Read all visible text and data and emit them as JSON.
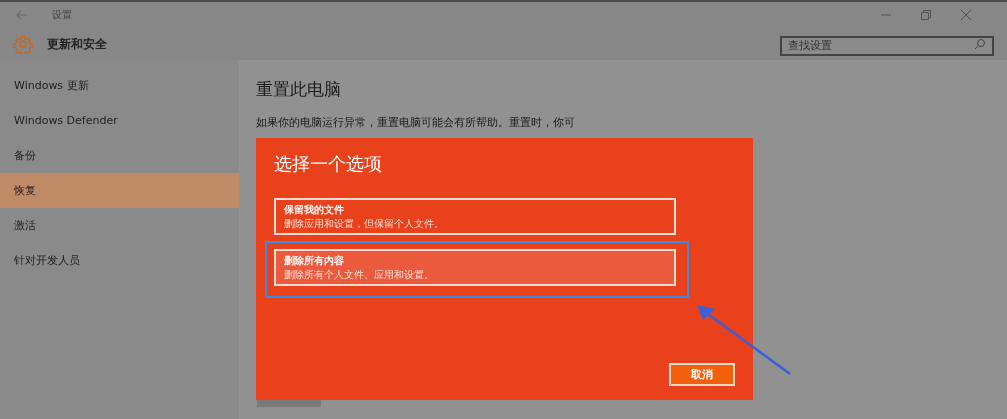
{
  "window": {
    "title": "设置"
  },
  "header": {
    "title": "更新和安全"
  },
  "search": {
    "placeholder": "查找设置"
  },
  "sidebar": {
    "items": [
      {
        "label": "Windows 更新",
        "selected": false
      },
      {
        "label": "Windows Defender",
        "selected": false
      },
      {
        "label": "备份",
        "selected": false
      },
      {
        "label": "恢复",
        "selected": true
      },
      {
        "label": "激活",
        "selected": false
      },
      {
        "label": "针对开发人员",
        "selected": false
      }
    ]
  },
  "content": {
    "title": "重置此电脑",
    "lines": [
      "如果你的电脑运行异常，重置电脑可能会有所帮助。重置时，你可"
    ]
  },
  "dialog": {
    "title": "选择一个选项",
    "options": [
      {
        "title": "保留我的文件",
        "description": "删除应用和设置，但保留个人文件。",
        "selected": false
      },
      {
        "title": "删除所有内容",
        "description": "删除所有个人文件、应用和设置。",
        "selected": true
      }
    ],
    "cancel_button": "取消"
  }
}
